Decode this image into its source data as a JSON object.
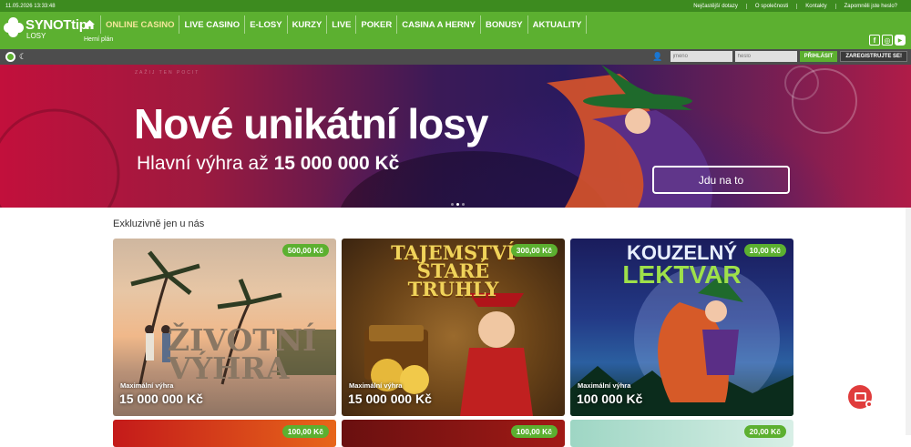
{
  "topbar": {
    "datetime": "11.05.2026 13:33:48",
    "links": [
      "Nejčastější dotazy",
      "O společnosti",
      "Kontakty",
      "Zapomněli jste heslo?"
    ]
  },
  "brand": {
    "name": "SYNOTtip",
    "sub": "LOSY"
  },
  "nav": {
    "items": [
      "ONLINE CASINO",
      "LIVE CASINO",
      "E-LOSY",
      "KURZY",
      "LIVE",
      "POKER",
      "CASINA A HERNY",
      "BONUSY",
      "AKTUALITY"
    ],
    "sub": "Herní plán"
  },
  "social": {
    "facebook": "f",
    "instagram": "◎",
    "youtube": "▶"
  },
  "login": {
    "name_placeholder": "jméno",
    "password_placeholder": "heslo",
    "login_label": "PŘIHLÁSIT",
    "register_label": "ZAREGISTRUJTE SE!"
  },
  "hero": {
    "tagline": "ZAŽIJ TEN POCIT",
    "title": "Nové unikátní losy",
    "subtitle_prefix": "Hlavní výhra až ",
    "subtitle_amount": "15 000 000 Kč",
    "cta": "Jdu na to"
  },
  "section": {
    "title": "Exkluzivně jen u nás"
  },
  "cards": [
    {
      "price": "500,00 Kč",
      "art": "ŽIVOTNÍ VÝHRA",
      "max_label": "Maximální výhra",
      "max_value": "15 000 000 Kč"
    },
    {
      "price": "300,00 Kč",
      "art": "TAJEMSTVÍ STARÉ TRUHLY",
      "max_label": "Maximální výhra",
      "max_value": "15 000 000 Kč"
    },
    {
      "price": "10,00 Kč",
      "art_top": "KOUZELNÝ",
      "art_bottom": "LEKTVAR",
      "max_label": "Maximální výhra",
      "max_value": "100 000 Kč"
    },
    {
      "price": "100,00 Kč"
    },
    {
      "price": "100,00 Kč"
    },
    {
      "price": "20,00 Kč"
    }
  ],
  "colors": {
    "primary_green": "#5cb030",
    "dark_green": "#3d8b1f",
    "chat_red": "#e03c3c"
  }
}
